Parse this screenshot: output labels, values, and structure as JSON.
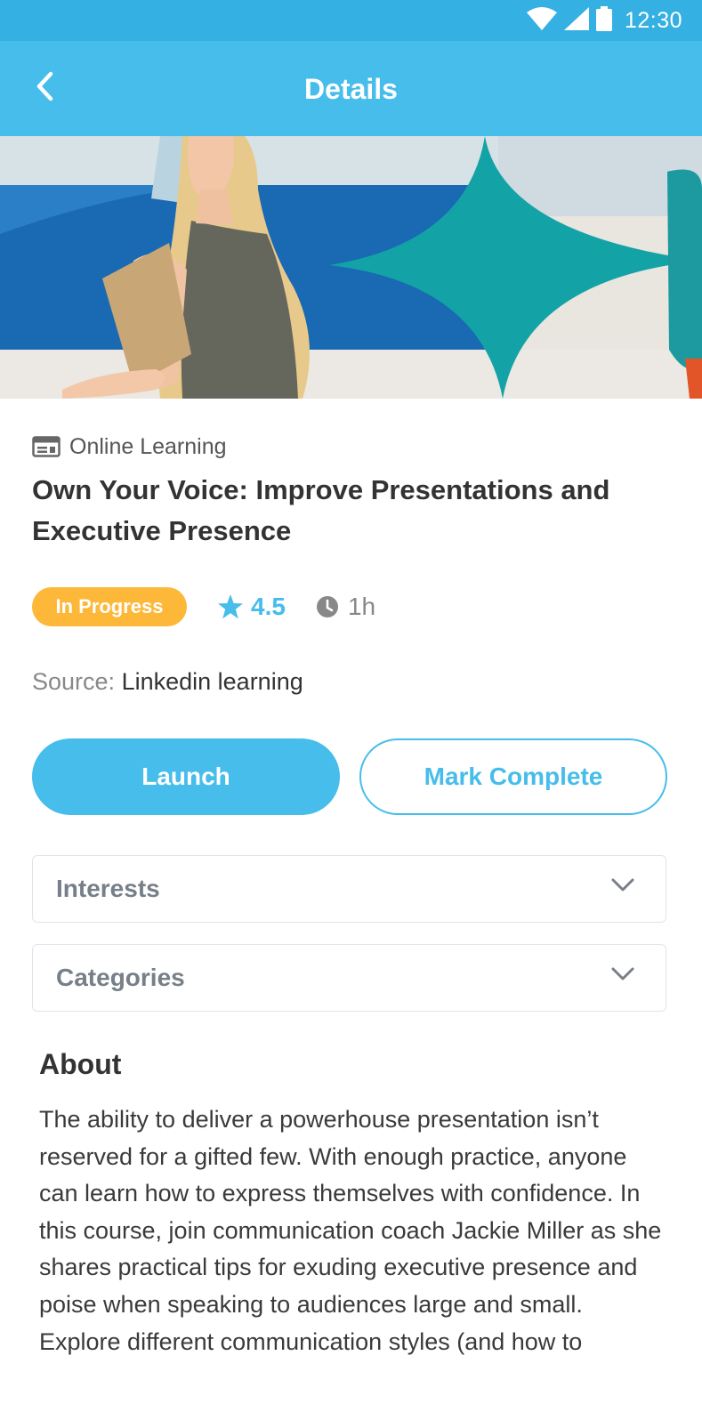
{
  "status_bar": {
    "time": "12:30",
    "icons": [
      "wifi-icon",
      "signal-icon",
      "battery-icon"
    ]
  },
  "app_bar": {
    "title": "Details",
    "back_icon": "chevron-left-icon"
  },
  "hero": {
    "description_icon": "hero-image"
  },
  "course": {
    "type_icon": "online-learning-icon",
    "type": "Online Learning",
    "title": "Own Your Voice: Improve Presentations and Executive Presence",
    "status": "In Progress",
    "rating": "4.5",
    "duration": "1h",
    "source_label": "Source:",
    "source_value": "Linkedin learning"
  },
  "actions": {
    "launch": "Launch",
    "mark_complete": "Mark Complete"
  },
  "accordions": {
    "interests": "Interests",
    "categories": "Categories"
  },
  "about": {
    "title": "About",
    "text": "The ability to deliver a powerhouse presentation isn’t reserved for a gifted few. With enough practice, anyone can learn how to express themselves with confidence. In this course, join communication coach Jackie Miller as she shares practical tips for exuding executive presence and poise when speaking to audiences large and small. Explore different communication styles (and how to"
  },
  "colors": {
    "status_bar": "#34b0e2",
    "app_bar": "#46bdeb",
    "accent": "#46bdeb",
    "badge": "#fdb839",
    "border": "#dfe4ec"
  }
}
